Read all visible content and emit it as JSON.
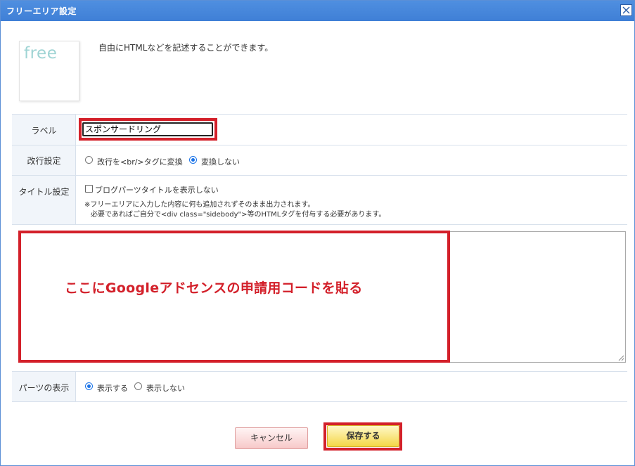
{
  "dialog": {
    "title": "フリーエリア設定",
    "close_symbol": "×"
  },
  "header": {
    "logo_text": "free",
    "description": "自由にHTMLなどを記述することができます。"
  },
  "form": {
    "label": {
      "label": "ラベル",
      "value": "スポンサードリング"
    },
    "line_break": {
      "label": "改行設定",
      "options": [
        "改行を<br/>タグに変換",
        "変換しない"
      ],
      "selected": "変換しない"
    },
    "title_setting": {
      "label": "タイトル設定",
      "checkbox_label": "ブログパーツタイトルを表示しない",
      "checked": false,
      "note_line1": "※フリーエリアに入力した内容に何も追加されずそのまま出力されます。",
      "note_line2": "必要であればご自分で<div class=\"sidebody\">等のHTMLタグを付与する必要があります。"
    },
    "content": {
      "annotation": "ここにGoogleアドセンスの申請用コードを貼る",
      "value": ""
    },
    "parts_display": {
      "label": "パーツの表示",
      "options": [
        "表示する",
        "表示しない"
      ],
      "selected": "表示する"
    }
  },
  "buttons": {
    "cancel": "キャンセル",
    "save": "保存する"
  },
  "colors": {
    "titlebar": "#4f8fe0",
    "highlight_red": "#d3202a",
    "radio_blue": "#1a73e8",
    "save_button": "#f4d648",
    "cancel_button": "#f7c9c9",
    "label_bg": "#f1f5fa"
  },
  "icons": {
    "close": "close-icon",
    "resize": "resize-grip-icon"
  }
}
